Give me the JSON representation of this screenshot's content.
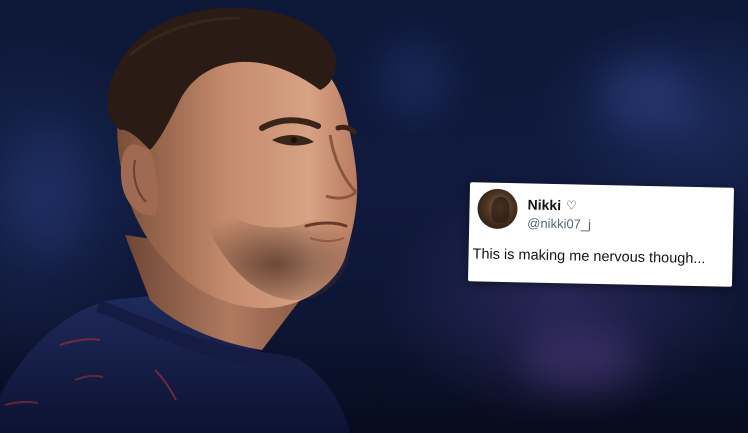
{
  "photo": {
    "subject": "soccer-player-portrait",
    "shirt_color": "#1a2450",
    "background_color": "#101a3d"
  },
  "tweet": {
    "name": "Nikki",
    "name_icon": "heart-outline-icon",
    "handle": "@nikki07_j",
    "text": "This is making me nervous though..."
  }
}
